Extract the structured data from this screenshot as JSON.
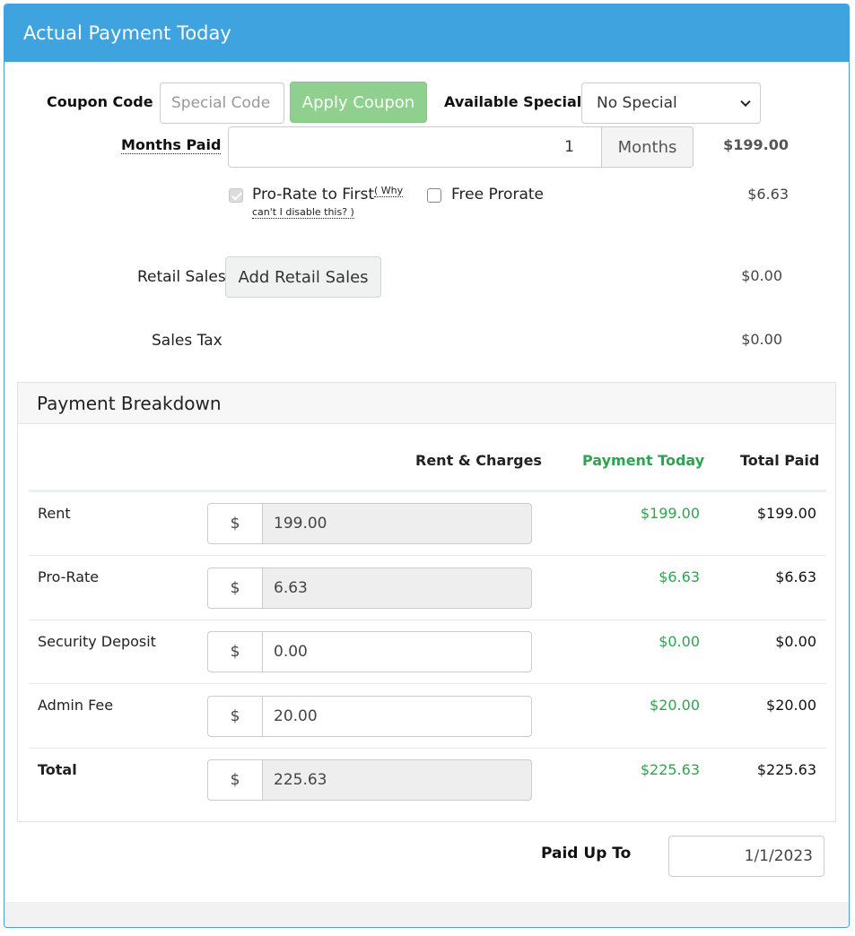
{
  "panel": {
    "title": "Actual Payment Today"
  },
  "coupon": {
    "label": "Coupon Code",
    "placeholder": "Special Code",
    "apply_label": "Apply Coupon"
  },
  "specials": {
    "label": "Available Specials",
    "selected": "No Special"
  },
  "months": {
    "label": "Months Paid",
    "value": "1",
    "unit": "Months",
    "amount": "$199.00"
  },
  "prorate": {
    "label": "Pro-Rate to First",
    "why_line1": "( Why",
    "why_line2": "can't I disable this? )",
    "checked": true,
    "free_label": "Free Prorate",
    "free_checked": false,
    "amount": "$6.63"
  },
  "retail": {
    "label": "Retail Sales",
    "button_label": "Add Retail Sales",
    "amount": "$0.00"
  },
  "tax": {
    "label": "Sales Tax",
    "amount": "$0.00"
  },
  "breakdown": {
    "title": "Payment Breakdown",
    "headers": {
      "charges": "Rent & Charges",
      "today": "Payment Today",
      "total": "Total Paid"
    },
    "currency": "$",
    "rows": [
      {
        "label": "Rent",
        "value": "199.00",
        "today": "$199.00",
        "total": "$199.00",
        "readonly": true
      },
      {
        "label": "Pro-Rate",
        "value": "6.63",
        "today": "$6.63",
        "total": "$6.63",
        "readonly": true
      },
      {
        "label": "Security Deposit",
        "value": "0.00",
        "today": "$0.00",
        "total": "$0.00",
        "readonly": false
      },
      {
        "label": "Admin Fee",
        "value": "20.00",
        "today": "$20.00",
        "total": "$20.00",
        "readonly": false
      },
      {
        "label": "Total",
        "value": "225.63",
        "today": "$225.63",
        "total": "$225.63",
        "readonly": true
      }
    ]
  },
  "paid_up_to": {
    "label": "Paid Up To",
    "value": "1/1/2023"
  },
  "colors": {
    "header_blue": "#3ea3de",
    "accent_green": "#2fa44f",
    "apply_button": "#8fd08f"
  }
}
